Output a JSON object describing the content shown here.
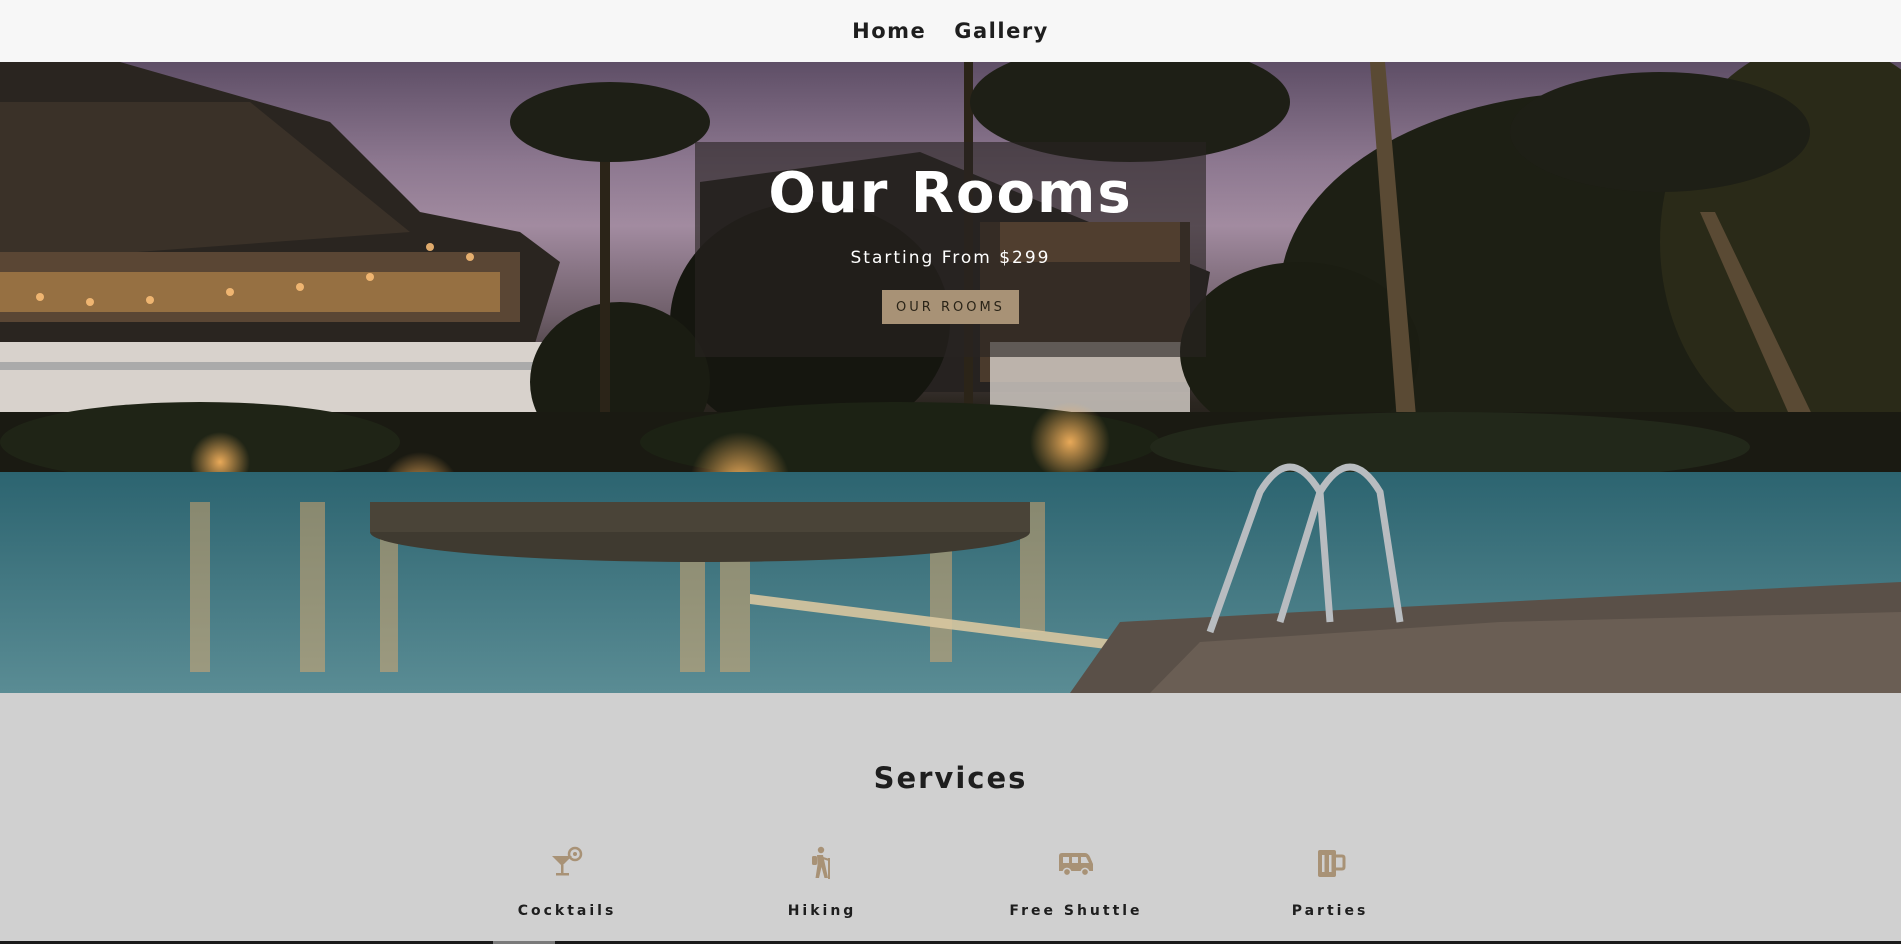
{
  "nav": {
    "items": [
      {
        "label": "Home"
      },
      {
        "label": "Gallery"
      }
    ]
  },
  "hero": {
    "title": "Our Rooms",
    "subtitle": "Starting From $299",
    "button_label": "OUR ROOMS"
  },
  "services": {
    "title": "Services",
    "items": [
      {
        "label": "Cocktails",
        "icon": "cocktail-icon"
      },
      {
        "label": "Hiking",
        "icon": "hiking-icon"
      },
      {
        "label": "Free Shuttle",
        "icon": "shuttle-van-icon"
      },
      {
        "label": "Parties",
        "icon": "beer-mug-icon"
      }
    ]
  },
  "colors": {
    "accent": "#a89276",
    "nav_bg": "#f7f7f7",
    "services_bg": "#d0d0d0"
  }
}
